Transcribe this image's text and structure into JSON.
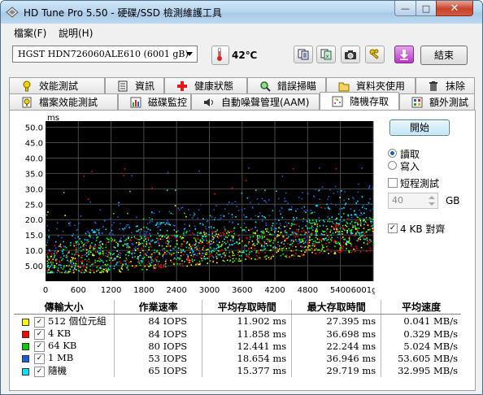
{
  "window": {
    "title": "HD Tune Pro 5.50 - 硬碟/SSD 檢測維護工具",
    "minimize_glyph": "—",
    "maximize_glyph": "□",
    "close_glyph": "✕"
  },
  "menu": {
    "items": [
      "檔案(F)",
      "說明(H)"
    ]
  },
  "toolbar": {
    "drive": "HGST HDN726060ALE610 (6001 gB)",
    "temperature": "42℃",
    "exit_label": "結束",
    "icons": [
      "copy-info-icon",
      "copy-info-excel-icon",
      "screenshot-camera-icon",
      "options-keys-icon",
      "save-download-icon"
    ]
  },
  "tabs_row1": [
    {
      "label": "效能測試",
      "icon": "benchmark-icon"
    },
    {
      "label": "資訊",
      "icon": "info-icon"
    },
    {
      "label": "健康狀態",
      "icon": "health-icon"
    },
    {
      "label": "錯誤掃瞄",
      "icon": "error-scan-icon"
    },
    {
      "label": "資料夾使用",
      "icon": "folder-usage-icon"
    },
    {
      "label": "抹除",
      "icon": "erase-icon"
    }
  ],
  "tabs_row2": [
    {
      "label": "檔案效能測試",
      "icon": "file-benchmark-icon"
    },
    {
      "label": "磁碟監控",
      "icon": "disk-monitor-icon"
    },
    {
      "label": "自動噪聲管理(AAM)",
      "icon": "aam-speaker-icon"
    },
    {
      "label": "隨機存取",
      "icon": "random-access-icon",
      "active": true
    },
    {
      "label": "額外測試",
      "icon": "extra-tests-icon"
    }
  ],
  "controls": {
    "start_label": "開始",
    "read_label": "讀取",
    "write_label": "寫入",
    "mode_selected": "讀取",
    "short_stroke_label": "短程測試",
    "short_stroke_checked": false,
    "short_stroke_value": "40",
    "short_stroke_unit": "GB",
    "align_label": "4 KB 對齊",
    "align_checked": true
  },
  "chart_data": {
    "type": "scatter",
    "ylabel": "ms",
    "xlabel": "",
    "y_ticks": [
      "50.0",
      "45.0",
      "40.0",
      "35.0",
      "30.0",
      "25.0",
      "20.0",
      "15.0",
      "10.0",
      "5.00"
    ],
    "x_ticks": [
      "0",
      "600",
      "1200",
      "1800",
      "2400",
      "3000",
      "3600",
      "4200",
      "4800",
      "5400",
      "6001gB"
    ],
    "xlim": [
      0,
      6001
    ],
    "ylim": [
      0,
      52
    ],
    "grid": true,
    "background": "#000000",
    "series": [
      {
        "name": "512 個位元組",
        "color": "#ffff00",
        "avg_ms": 11.902,
        "max_ms": 27.395
      },
      {
        "name": "4 KB",
        "color": "#ff0000",
        "avg_ms": 11.858,
        "max_ms": 36.698
      },
      {
        "name": "64 KB",
        "color": "#00ff00",
        "avg_ms": 12.441,
        "max_ms": 22.244
      },
      {
        "name": "1 MB",
        "color": "#1e5bd6",
        "avg_ms": 18.654,
        "max_ms": 36.946
      },
      {
        "name": "隨機",
        "color": "#00e5ff",
        "avg_ms": 15.377,
        "max_ms": 29.719
      }
    ]
  },
  "results": {
    "headers": [
      "傳輸大小",
      "作業速率",
      "平均存取時間",
      "最大存取時間",
      "平均速度"
    ],
    "rows": [
      {
        "name": "512 個位元組",
        "color": "#ffff00",
        "iops": "84 IOPS",
        "avg": "11.902 ms",
        "max": "27.395 ms",
        "speed": "0.041 MB/s"
      },
      {
        "name": "4 KB",
        "color": "#ff0000",
        "iops": "84 IOPS",
        "avg": "11.858 ms",
        "max": "36.698 ms",
        "speed": "0.329 MB/s"
      },
      {
        "name": "64 KB",
        "color": "#00cc00",
        "iops": "80 IOPS",
        "avg": "12.441 ms",
        "max": "22.244 ms",
        "speed": "5.024 MB/s"
      },
      {
        "name": "1 MB",
        "color": "#1e5bd6",
        "iops": "53 IOPS",
        "avg": "18.654 ms",
        "max": "36.946 ms",
        "speed": "53.605 MB/s"
      },
      {
        "name": "隨機",
        "color": "#00e5ff",
        "iops": "65 IOPS",
        "avg": "15.377 ms",
        "max": "29.719 ms",
        "speed": "32.995 MB/s"
      }
    ]
  }
}
